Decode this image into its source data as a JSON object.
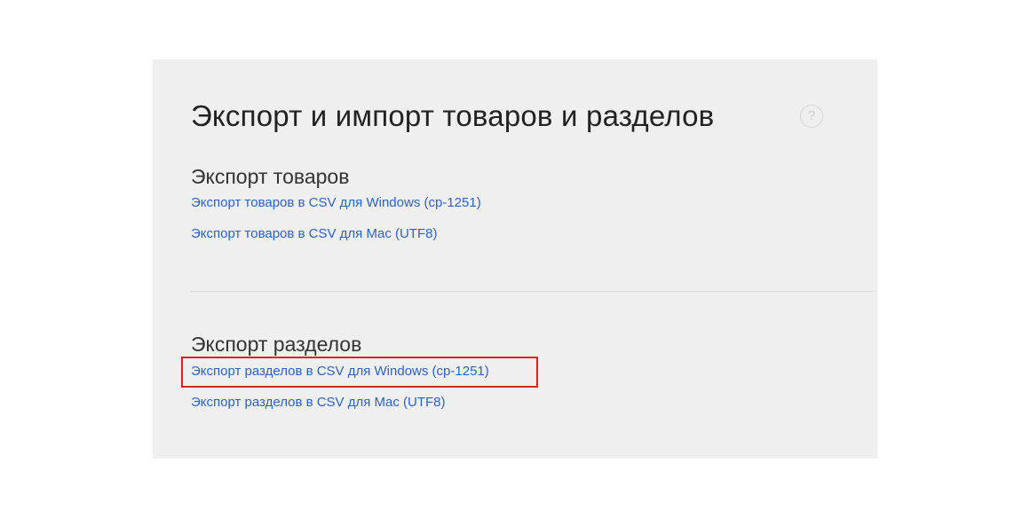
{
  "page": {
    "title": "Экспорт и импорт товаров и разделов",
    "help_icon": "?"
  },
  "sections": [
    {
      "title": "Экспорт товаров",
      "links": [
        "Экспорт товаров в CSV для Windows (cp-1251)",
        "Экспорт товаров в CSV для Mac (UTF8)"
      ]
    },
    {
      "title": "Экспорт разделов",
      "links": [
        "Экспорт разделов в CSV для Windows (cp-1251)",
        "Экспорт разделов в CSV для Mac (UTF8)"
      ]
    }
  ],
  "colors": {
    "link": "#2b62c9",
    "panel_background": "#efefef",
    "highlight": "#e0201c"
  },
  "icons": {
    "help": "question-circle-icon"
  }
}
